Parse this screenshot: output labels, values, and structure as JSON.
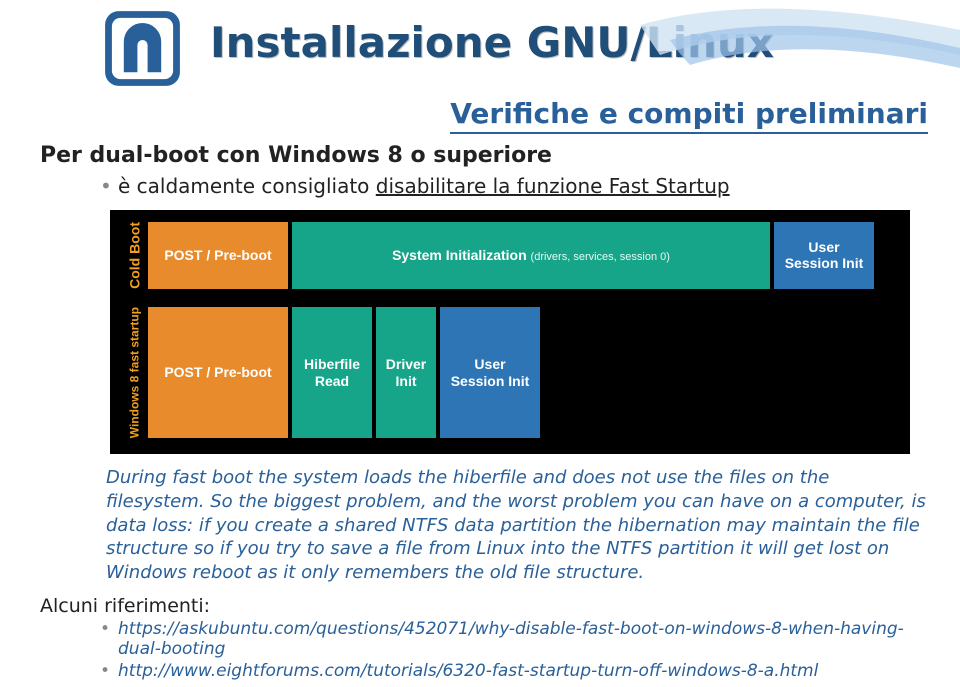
{
  "header": {
    "title": "Installazione GNU/Linux",
    "subtitle": "Verifiche e compiti preliminari"
  },
  "section": {
    "heading": "Per dual-boot con Windows 8 o superiore",
    "bullet_prefix": "è caldamente consigliato ",
    "bullet_linktext": "disabilitare la funzione Fast Startup"
  },
  "diagram": {
    "row1": {
      "vlabel": "Cold Boot",
      "cells": {
        "post": "POST / Pre-boot",
        "sysinit": "System Initialization",
        "sysinit_sub": "(drivers, services, session 0)",
        "user": "User Session Init"
      }
    },
    "row2": {
      "vlabel": "Windows 8 fast startup",
      "cells": {
        "post": "POST / Pre-boot",
        "hiber": "Hiberfile Read",
        "driver": "Driver Init",
        "user": "User Session Init"
      }
    }
  },
  "quote": "During fast boot the system loads the hiberfile and does not use the files on the filesystem. So the biggest problem, and the worst problem you can have on a computer, is data loss: if you create a shared NTFS data partition the hibernation may maintain the file structure so if you try to save a file from Linux into the NTFS partition it will get lost on Windows reboot as it only remembers the old file structure.",
  "refs": {
    "heading": "Alcuni riferimenti:",
    "links": [
      "https://askubuntu.com/questions/452071/why-disable-fast-boot-on-windows-8-when-having-dual-booting",
      "http://www.eightforums.com/tutorials/6320-fast-startup-turn-off-windows-8-a.html"
    ]
  },
  "icons": {
    "logo_name": "arch-logo",
    "swoosh_name": "swoosh-decoration"
  }
}
